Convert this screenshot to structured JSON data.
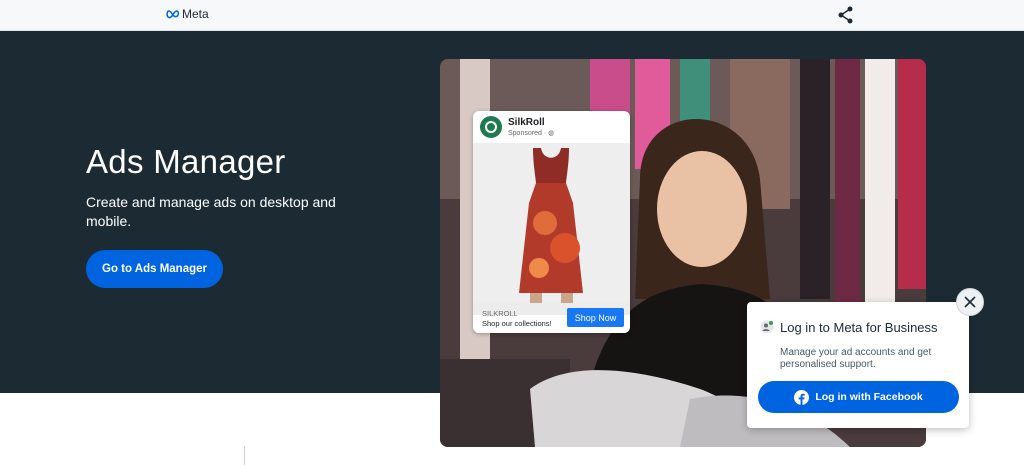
{
  "header": {
    "logo_text": "Meta",
    "logo_icon": "meta-logo-icon",
    "share_icon": "share-icon"
  },
  "hero": {
    "title": "Ads Manager",
    "description": "Create and manage ads on desktop and mobile.",
    "cta_label": "Go to Ads Manager"
  },
  "ad_preview": {
    "brand": "SilkRoll",
    "sponsored": "Sponsored · ",
    "footer_name": "SILKROLL",
    "footer_text": "Shop our collections!",
    "shop_button": "Shop Now"
  },
  "login_popup": {
    "title": "Log in to Meta for Business",
    "description": "Manage your ad accounts and get personalised support.",
    "button_label": "Log in with Facebook",
    "close_icon": "close-icon"
  },
  "colors": {
    "hero_background": "#1c2b33",
    "primary_button": "#0064e0",
    "facebook_blue": "#1877f2"
  }
}
